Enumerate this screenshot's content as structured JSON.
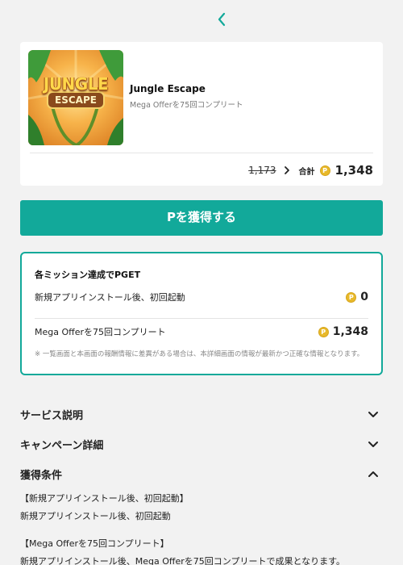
{
  "header": {
    "back_icon": "chevron-left-icon"
  },
  "app": {
    "name": "Jungle Escape",
    "subtitle": "Mega Offerを75回コンプリート",
    "thumb_title_line1": "JUNGLE",
    "thumb_title_line2": "ESCAPE",
    "old_price": "1,173",
    "total_label": "合計",
    "coin_symbol": "P",
    "total_value": "1,348"
  },
  "cta": {
    "label": "Pを獲得する"
  },
  "missions": {
    "title": "各ミッション達成でPGET",
    "items": [
      {
        "label": "新規アプリインストール後、初回起動",
        "points": "0"
      },
      {
        "label": "Mega Offerを75回コンプリート",
        "points": "1,348"
      }
    ],
    "note": "※ 一覧画面と本画面の報酬情報に差異がある場合は、本詳細画面の情報が最新かつ正確な情報となります。"
  },
  "sections": [
    {
      "title": "サービス説明",
      "state": "collapsed"
    },
    {
      "title": "キャンペーン詳細",
      "state": "collapsed"
    },
    {
      "title": "獲得条件",
      "state": "expanded"
    }
  ],
  "conditions": [
    {
      "heading": "【新規アプリインストール後、初回起動】",
      "body": "新規アプリインストール後、初回起動"
    },
    {
      "heading": "【Mega Offerを75回コンプリート】",
      "body": "新規アプリインストール後、Mega Offerを75回コンプリートで成果となります。"
    }
  ],
  "colors": {
    "accent": "#12a99a",
    "coin": "#e8b92a",
    "background": "#f2f2f2"
  }
}
